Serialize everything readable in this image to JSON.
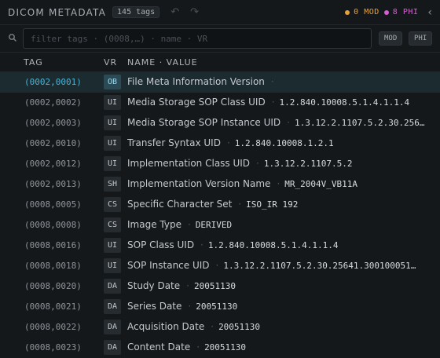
{
  "header": {
    "title": "DICOM METADATA",
    "tag_count": "145 tags",
    "undo_icon": "↶",
    "redo_icon": "↷",
    "mod_stat": "0 MOD",
    "phi_stat": "8 PHI",
    "collapse_icon": "‹",
    "colors": {
      "mod": "#e6a23a",
      "phi": "#d45fd0",
      "accent": "#48b3d6"
    }
  },
  "search": {
    "placeholder": "filter tags · (0008,…) · name · VR",
    "value": "",
    "chip_mod": "MOD",
    "chip_phi": "PHI"
  },
  "columns": {
    "tag": "TAG",
    "vr": "VR",
    "name_value": "NAME · VALUE"
  },
  "rows": [
    {
      "tag": "(0002,0001)",
      "vr": "OB",
      "name": "File Meta Information Version",
      "value": ""
    },
    {
      "tag": "(0002,0002)",
      "vr": "UI",
      "name": "Media Storage SOP Class UID",
      "value": "1.2.840.10008.5.1.4.1.1.4"
    },
    {
      "tag": "(0002,0003)",
      "vr": "UI",
      "name": "Media Storage SOP Instance UID",
      "value": "1.3.12.2.1107.5.2.30.256…"
    },
    {
      "tag": "(0002,0010)",
      "vr": "UI",
      "name": "Transfer Syntax UID",
      "value": "1.2.840.10008.1.2.1"
    },
    {
      "tag": "(0002,0012)",
      "vr": "UI",
      "name": "Implementation Class UID",
      "value": "1.3.12.2.1107.5.2"
    },
    {
      "tag": "(0002,0013)",
      "vr": "SH",
      "name": "Implementation Version Name",
      "value": "MR_2004V_VB11A"
    },
    {
      "tag": "(0008,0005)",
      "vr": "CS",
      "name": "Specific Character Set",
      "value": "ISO_IR 192"
    },
    {
      "tag": "(0008,0008)",
      "vr": "CS",
      "name": "Image Type",
      "value": "DERIVED"
    },
    {
      "tag": "(0008,0016)",
      "vr": "UI",
      "name": "SOP Class UID",
      "value": "1.2.840.10008.5.1.4.1.1.4"
    },
    {
      "tag": "(0008,0018)",
      "vr": "UI",
      "name": "SOP Instance UID",
      "value": "1.3.12.2.1107.5.2.30.25641.300100051…"
    },
    {
      "tag": "(0008,0020)",
      "vr": "DA",
      "name": "Study Date",
      "value": "20051130"
    },
    {
      "tag": "(0008,0021)",
      "vr": "DA",
      "name": "Series Date",
      "value": "20051130"
    },
    {
      "tag": "(0008,0022)",
      "vr": "DA",
      "name": "Acquisition Date",
      "value": "20051130"
    },
    {
      "tag": "(0008,0023)",
      "vr": "DA",
      "name": "Content Date",
      "value": "20051130"
    }
  ],
  "selected_row": 0,
  "row_separator": "·"
}
